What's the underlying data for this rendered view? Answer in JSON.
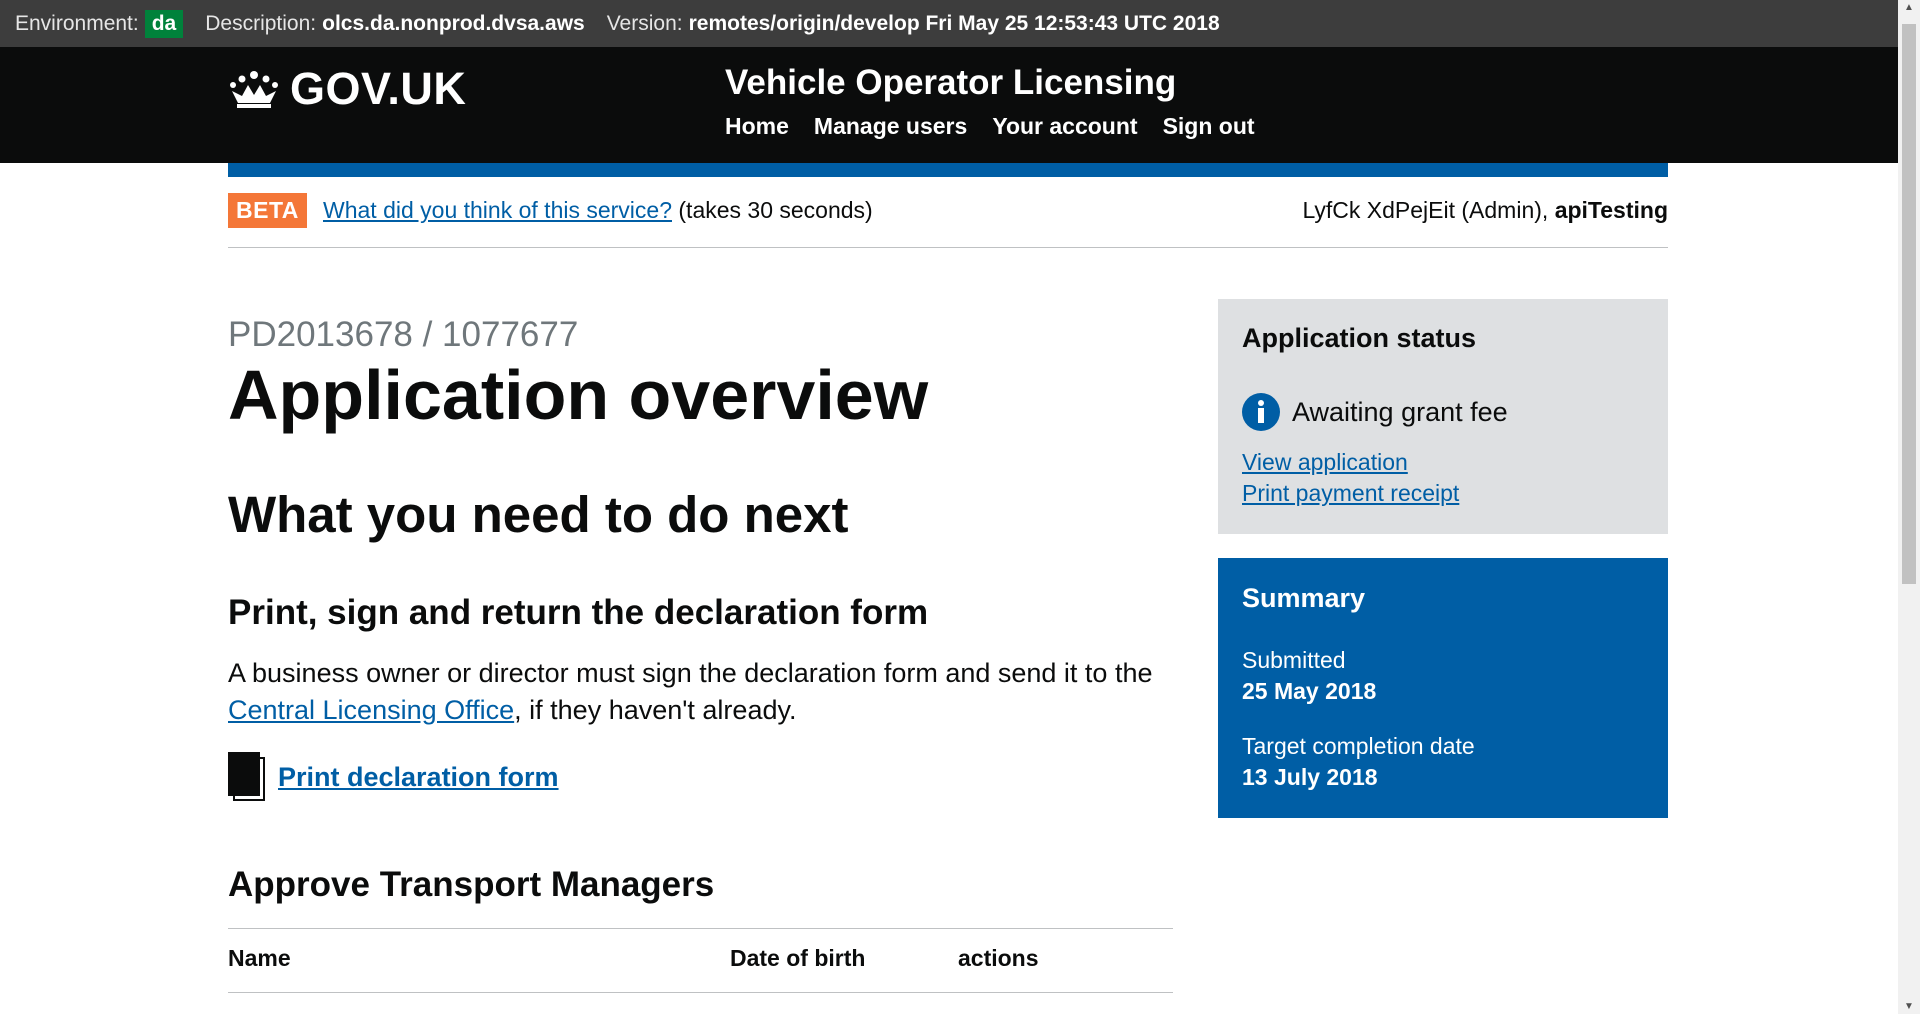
{
  "env_bar": {
    "environment_label": "Environment:",
    "environment_value": "da",
    "description_label": "Description:",
    "description_value": "olcs.da.nonprod.dvsa.aws",
    "version_label": "Version:",
    "version_value": "remotes/origin/develop Fri May 25 12:53:43 UTC 2018"
  },
  "header": {
    "logo_text": "GOV.UK",
    "service_name": "Vehicle Operator Licensing",
    "nav": [
      "Home",
      "Manage users",
      "Your account",
      "Sign out"
    ]
  },
  "phase_banner": {
    "tag": "BETA",
    "feedback_link": "What did you think of this service?",
    "feedback_suffix": "(takes 30 seconds)",
    "user_name": "LyfCk XdPejEit (Admin),",
    "user_org": "apiTesting"
  },
  "main": {
    "caption": "PD2013678 / 1077677",
    "title": "Application overview",
    "next_heading": "What you need to do next",
    "declaration_heading": "Print, sign and return the declaration form",
    "declaration_text_before": "A business owner or director must sign the declaration form and send it to the",
    "declaration_link": "Central Licensing Office",
    "declaration_text_after": ", if they haven't already.",
    "print_link": "Print declaration form",
    "tm_heading": "Approve Transport Managers",
    "tm_columns": [
      "Name",
      "Date of birth",
      "actions"
    ]
  },
  "sidebar": {
    "status_title": "Application status",
    "status_value": "Awaiting grant fee",
    "status_links": [
      "View application",
      "Print payment receipt"
    ],
    "summary_title": "Summary",
    "submitted_label": "Submitted",
    "submitted_value": "25 May 2018",
    "target_label": "Target completion date",
    "target_value": "13 July 2018"
  },
  "colors": {
    "header_bg": "#0b0c0c",
    "brand_blue": "#005ea5",
    "beta_orange": "#f47738",
    "env_green": "#00823b",
    "status_grey": "#dee0e2"
  },
  "icons": [
    "crown-icon",
    "info-icon",
    "document-icon"
  ]
}
